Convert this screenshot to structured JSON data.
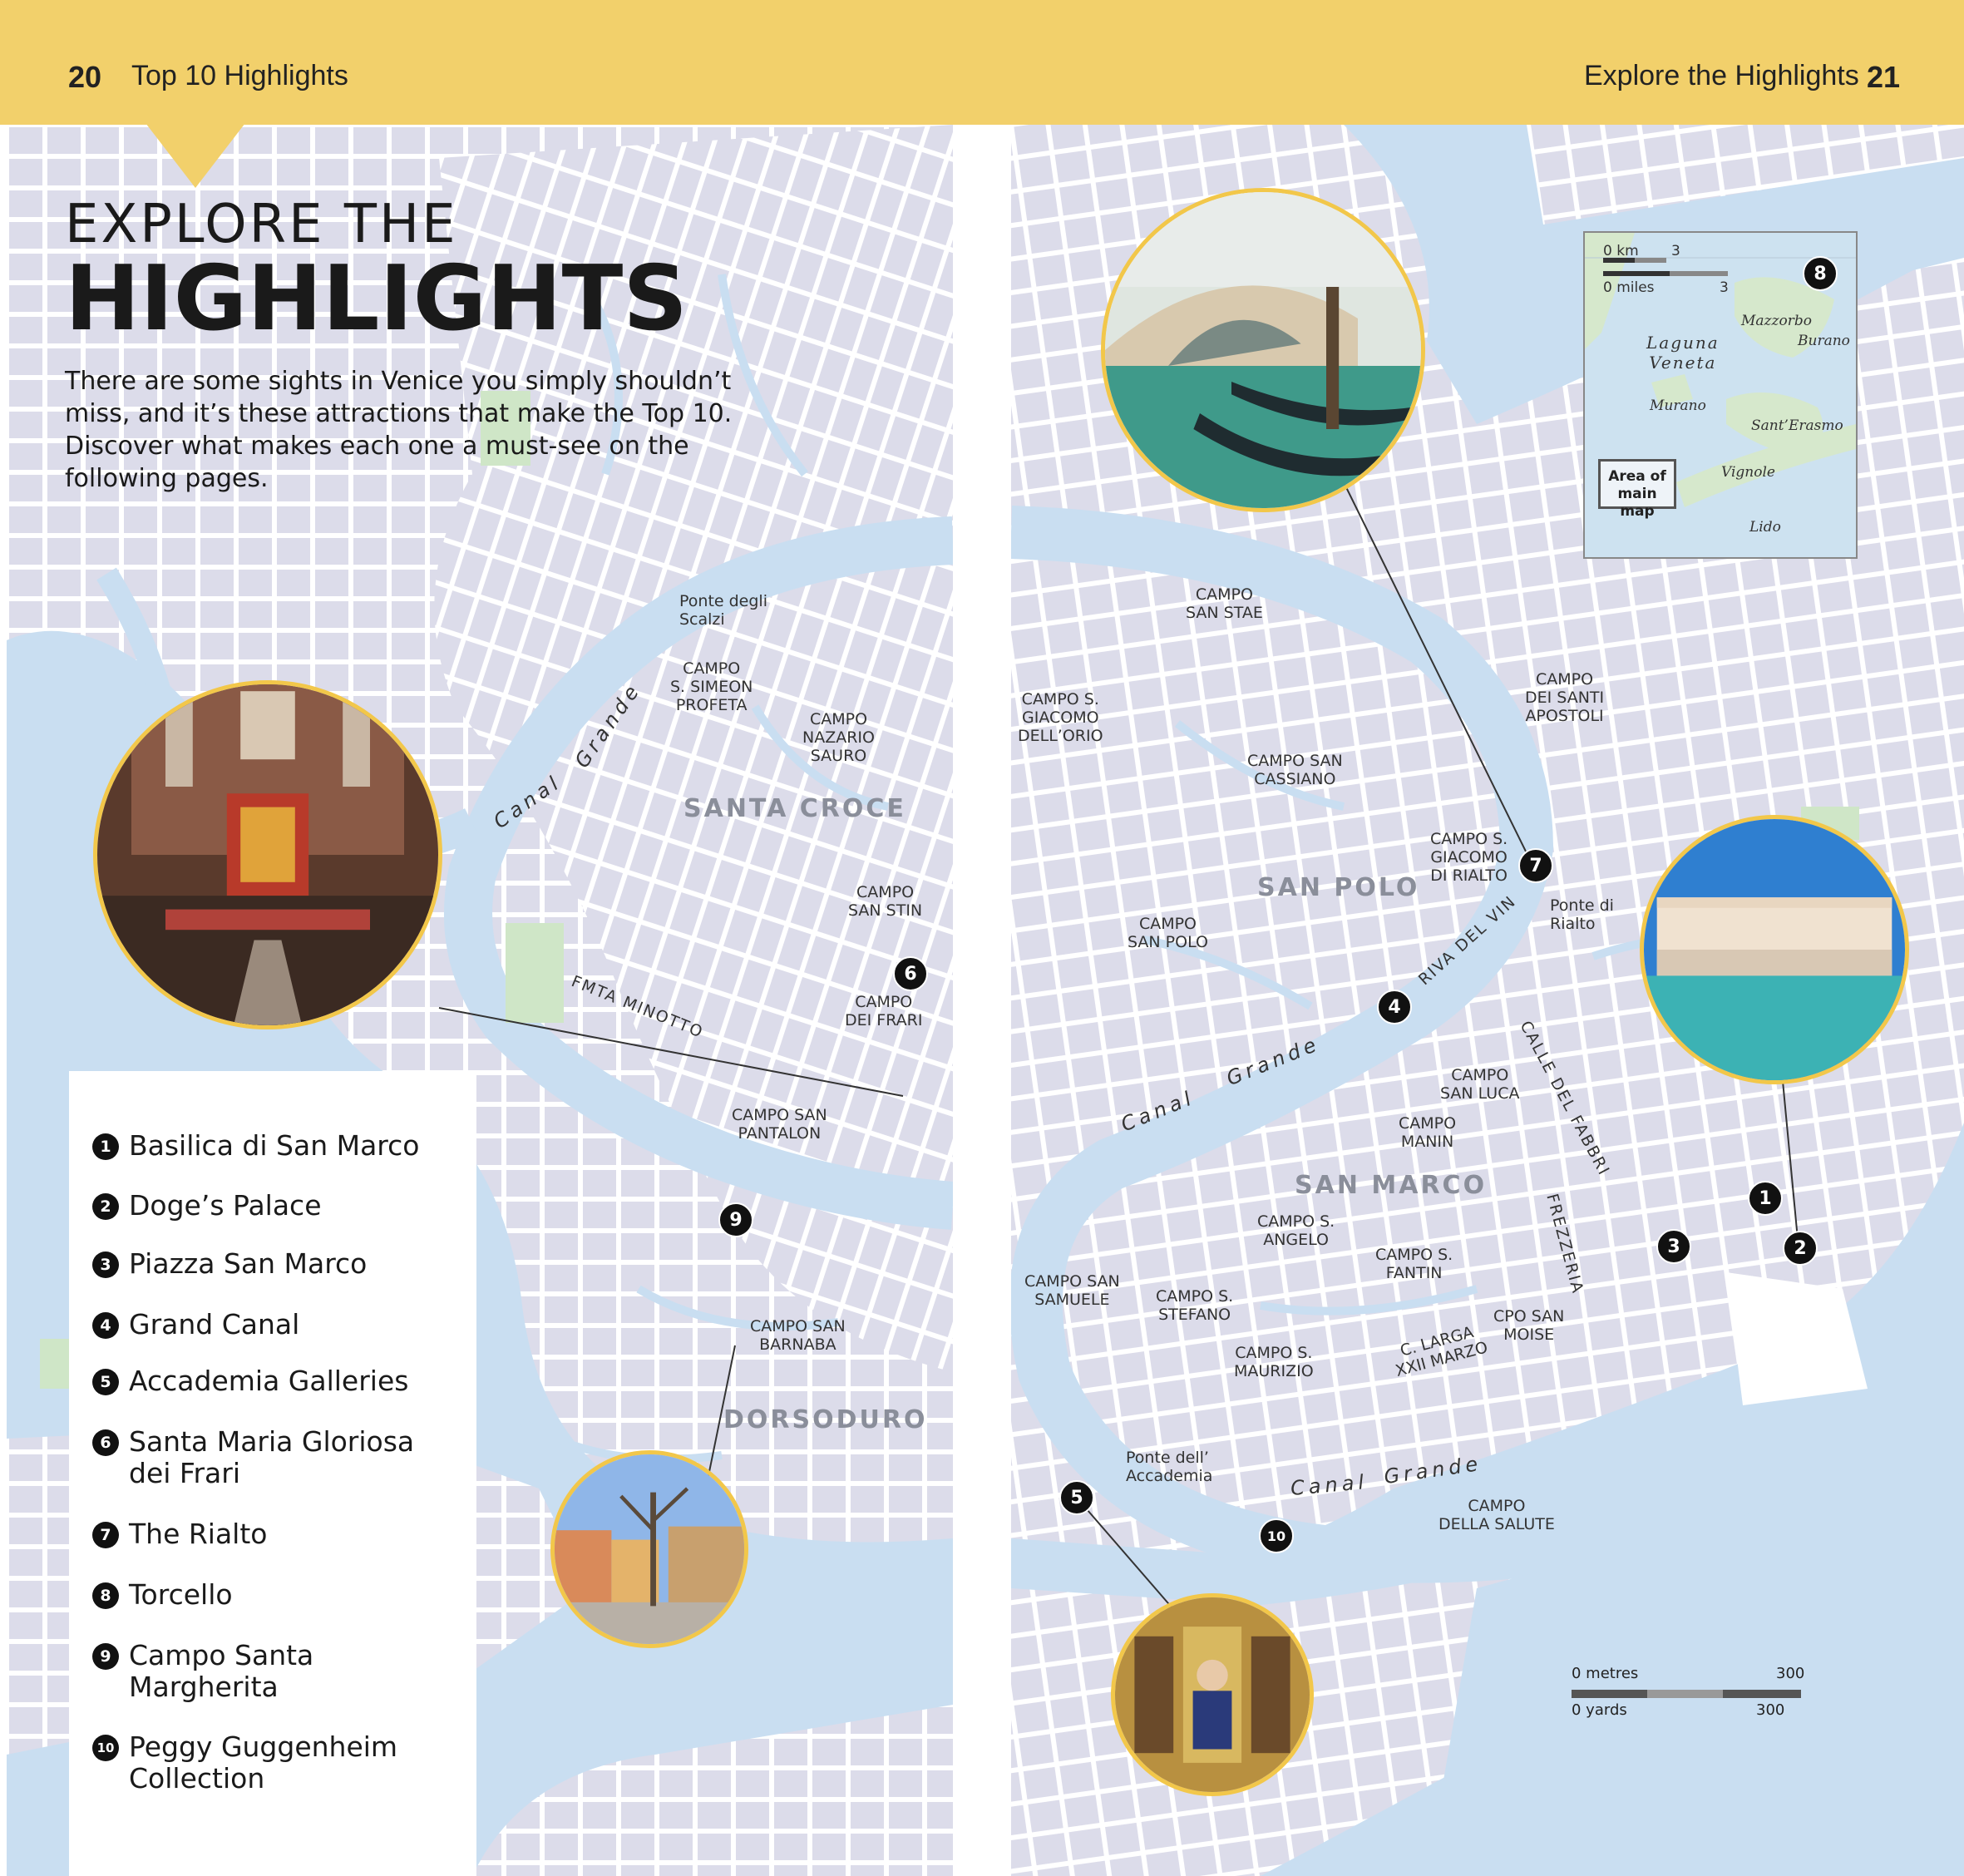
{
  "header": {
    "left_page_num": "20",
    "left_title": "Top 10 Highlights",
    "right_title": "Explore the Highlights",
    "right_page_num": "21"
  },
  "intro": {
    "line1": "EXPLORE THE",
    "line2": "HIGHLIGHTS",
    "body": "There are some sights in Venice you simply shouldn’t miss, and it’s these attractions that make the Top 10. Discover what makes each one a must-see on the following pages."
  },
  "legend": [
    {
      "num": "1",
      "label": "Basilica di San Marco"
    },
    {
      "num": "2",
      "label": "Doge’s Palace"
    },
    {
      "num": "3",
      "label": "Piazza San Marco"
    },
    {
      "num": "4",
      "label": "Grand Canal"
    },
    {
      "num": "5",
      "label": "Accademia Galleries"
    },
    {
      "num": "6",
      "label": "Santa Maria Gloriosa dei Frari"
    },
    {
      "num": "7",
      "label": "The Rialto"
    },
    {
      "num": "8",
      "label": "Torcello"
    },
    {
      "num": "9",
      "label": "Campo Santa Margherita"
    },
    {
      "num": "10",
      "label": "Peggy Guggenheim Collection"
    }
  ],
  "districts": {
    "santa_croce": "SANTA CROCE",
    "dorsoduro": "DORSODURO",
    "san_polo": "SAN POLO",
    "san_marco": "SAN MARCO"
  },
  "places": {
    "ponte_scalzi": "Ponte degli\nScalzi",
    "simeon": "CAMPO\nS. SIMEON\nPROFETA",
    "nazario": "CAMPO\nNAZARIO\nSAURO",
    "san_stin": "CAMPO\nSAN STIN",
    "frari": "CAMPO\nDEI FRARI",
    "pantalon": "CAMPO SAN\nPANTALON",
    "barnaba": "CAMPO SAN\nBARNABA",
    "san_stae": "CAMPO\nSAN STAE",
    "giacomo_orio": "CAMPO S.\nGIACOMO\nDELL’ORIO",
    "cassiano": "CAMPO SAN\nCASSIANO",
    "giacomo_rialto": "CAMPO S.\nGIACOMO\nDI RIALTO",
    "ponte_rialto": "Ponte di\nRialto",
    "santi_apostoli": "CAMPO\nDEI SANTI\nAPOSTOLI",
    "san_polo": "CAMPO\nSAN POLO",
    "san_luca": "CAMPO\nSAN LUCA",
    "manin": "CAMPO\nMANIN",
    "angelo": "CAMPO S.\nANGELO",
    "fantin": "CAMPO S.\nFANTIN",
    "samuele": "CAMPO SAN\nSAMUELE",
    "stefano": "CAMPO S.\nSTEFANO",
    "maurizio": "CAMPO S.\nMAURIZIO",
    "moise": "CPO SAN\nMOISE",
    "ponte_accademia": "Ponte dell’\nAccademia",
    "salute": "CAMPO\nDELLA SALUTE"
  },
  "streets": {
    "minotto": "FMTA MINOTTO",
    "riva_vin": "RIVA DEL VIN",
    "fabbri": "CALLE DEL FABBRI",
    "frezzeria": "FREZZERIA",
    "larga": "C. LARGA\nXXII MARZO"
  },
  "canal_labels": {
    "canal": "Canal",
    "grande": "Grande"
  },
  "markers": [
    "1",
    "2",
    "3",
    "4",
    "5",
    "6",
    "7",
    "8",
    "9",
    "10"
  ],
  "inset_map": {
    "km_label": "0 km",
    "km_value": "3",
    "miles_label": "0 miles",
    "miles_value": "3",
    "laguna": "Laguna\nVeneta",
    "mazzorbo": "Mazzorbo",
    "burano": "Burano",
    "murano": "Murano",
    "sant_erasmo": "Sant’Erasmo",
    "vignole": "Vignole",
    "lido": "Lido",
    "area_label": "Area of\nmain map"
  },
  "scale_bar": {
    "metres_label": "0 metres",
    "metres_value": "300",
    "yards_label": "0 yards",
    "yards_value": "300"
  },
  "colors": {
    "header": "#f2d06b",
    "water": "#c9def1",
    "land": "#dcdcea",
    "photo_border": "#f2c74a"
  }
}
